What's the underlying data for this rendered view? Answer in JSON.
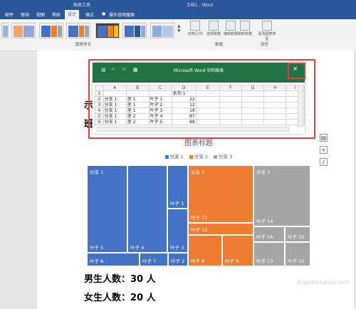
{
  "window": {
    "context_tab": "图表工具",
    "doc_title": "文档1 - Word"
  },
  "tabs": [
    {
      "label": "邮件",
      "active": false
    },
    {
      "label": "审阅",
      "active": false
    },
    {
      "label": "视图",
      "active": false
    },
    {
      "label": "帮助",
      "active": false
    },
    {
      "label": "设计",
      "active": true
    },
    {
      "label": "格式",
      "active": false
    }
  ],
  "tell_me": "操作说明搜索",
  "ribbon": {
    "group_styles": "图表样式",
    "group_data": "数据",
    "group_type": "类型",
    "btn_switch": "切换行/列",
    "btn_select": "选择数据",
    "btn_edit": "编辑数据",
    "btn_refresh": "刷新数据",
    "btn_change_type": "更改图表类型"
  },
  "document": {
    "partial_1": "示",
    "partial_2": "班",
    "male": "男生人数：30 人",
    "female": "女生人数：20 人"
  },
  "excel": {
    "title": "Microsoft Word 中的图表",
    "close": "×",
    "columns": [
      "A",
      "B",
      "C",
      "D",
      "E",
      "F",
      "G",
      "H",
      "I"
    ],
    "rows": [
      [
        "1",
        "",
        "",
        "",
        "系列 1",
        "",
        "",
        "",
        "",
        ""
      ],
      [
        "2",
        "分支 1",
        "茎 1",
        "叶子 1",
        "22",
        "",
        "",
        "",
        "",
        ""
      ],
      [
        "3",
        "分支 1",
        "茎 1",
        "叶子 2",
        "12",
        "",
        "",
        "",
        "",
        ""
      ],
      [
        "4",
        "分支 1",
        "茎 1",
        "叶子 3",
        "18",
        "",
        "",
        "",
        "",
        ""
      ],
      [
        "5",
        "分支 1",
        "茎 2",
        "叶子 4",
        "87",
        "",
        "",
        "",
        "",
        ""
      ],
      [
        "6",
        "分支 1",
        "茎 2",
        "叶子 5",
        "88",
        "",
        "",
        "",
        "",
        ""
      ]
    ]
  },
  "chart_data": {
    "type": "treemap",
    "title": "图表标题",
    "legend": [
      "分支 1",
      "分支 2",
      "分支 3"
    ],
    "colors": {
      "分支 1": "#4472c4",
      "分支 2": "#ed7d31",
      "分支 3": "#a5a5a5"
    },
    "tiles": [
      {
        "label": "叶子 5",
        "branch": "分支 1",
        "header": "分支 1"
      },
      {
        "label": "叶子 4",
        "branch": "分支 1"
      },
      {
        "label": "叶子 1",
        "branch": "分支 1"
      },
      {
        "label": "叶子 3",
        "branch": "分支 1"
      },
      {
        "label": "叶子 6",
        "branch": "分支 1"
      },
      {
        "label": "叶子 7",
        "branch": "分支 1"
      },
      {
        "label": "叶子 2",
        "branch": "分支 1"
      },
      {
        "label": "叶子 11",
        "branch": "分支 2",
        "header": "分支 2"
      },
      {
        "label": "叶子 10",
        "branch": "分支 2"
      },
      {
        "label": "叶子 8",
        "branch": "分支 2"
      },
      {
        "label": "叶子 9",
        "branch": "分支 2"
      },
      {
        "label": "叶子 14",
        "branch": "分支 3",
        "header": "分支 3"
      },
      {
        "label": "叶子 16",
        "branch": "分支 3"
      },
      {
        "label": "叶子 15",
        "branch": "分支 3"
      },
      {
        "label": "叶子 13",
        "branch": "分支 3"
      },
      {
        "label": "叶子 12",
        "branch": "分支 3"
      }
    ]
  },
  "watermark": "Jingyan.baidu.com"
}
